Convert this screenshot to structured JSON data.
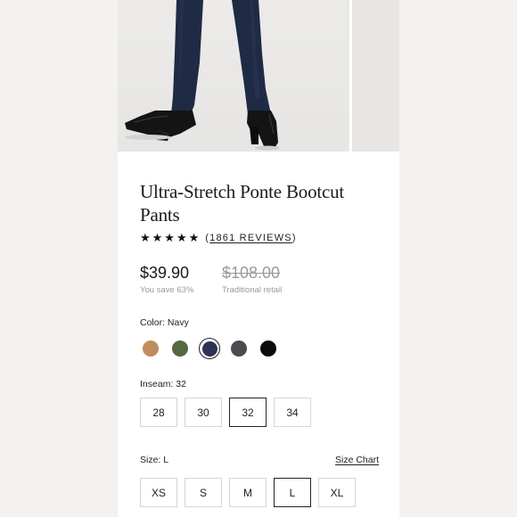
{
  "product": {
    "title": "Ultra-Stretch Ponte Bootcut Pants",
    "rating": {
      "stars": "★★★★★",
      "open": "(",
      "reviews": "1861 REVIEWS",
      "close": ")"
    },
    "price": "$39.90",
    "savings": "You save 63%",
    "original_price": "$108.00",
    "original_note": "Traditional retail"
  },
  "color": {
    "label": "Color: Navy",
    "swatches": [
      {
        "name": "Camel",
        "hex": "#c08c5f",
        "selected": false
      },
      {
        "name": "Olive",
        "hex": "#56683f",
        "selected": false
      },
      {
        "name": "Navy",
        "hex": "#2e3355",
        "selected": true
      },
      {
        "name": "Charcoal",
        "hex": "#4a4b50",
        "selected": false
      },
      {
        "name": "Black",
        "hex": "#0b0b0b",
        "selected": false
      }
    ]
  },
  "inseam": {
    "label": "Inseam: 32",
    "options": [
      "28",
      "30",
      "32",
      "34"
    ],
    "selected": "32"
  },
  "size": {
    "label": "Size: L",
    "chart_link": "Size Chart",
    "options": [
      "XS",
      "S",
      "M",
      "L",
      "XL"
    ],
    "selected": "L"
  },
  "colors": {
    "pants": "#1f2a44",
    "boots": "#141414"
  }
}
